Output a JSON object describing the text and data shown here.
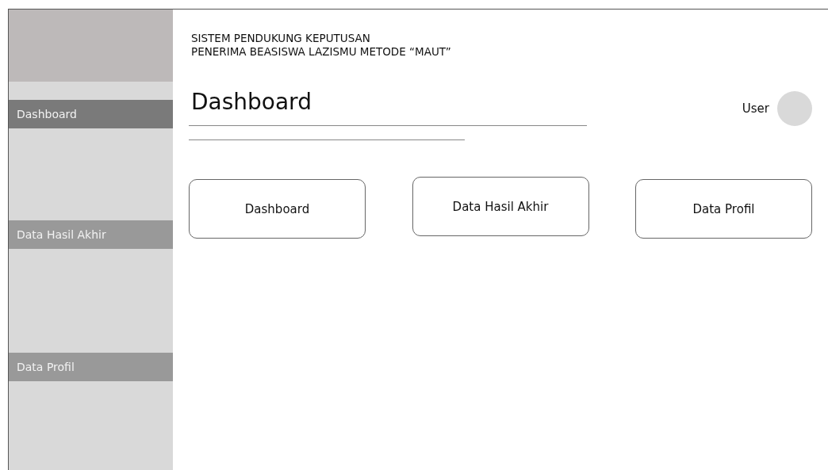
{
  "header": {
    "title_lines": [
      "SISTEM PENDUKUNG KEPUTUSAN",
      "PENERIMA BEASISWA LAZISMU METODE “MAUT”"
    ]
  },
  "sidebar": {
    "items": [
      {
        "label": "Dashboard",
        "selected": true
      },
      {
        "label": "Data Hasil Akhir",
        "selected": false
      },
      {
        "label": "Data Profil",
        "selected": false
      }
    ]
  },
  "page": {
    "heading": "Dashboard",
    "user": "User"
  },
  "cards": [
    {
      "label": "Dashboard"
    },
    {
      "label": "Data Hasil Akhir"
    },
    {
      "label": "Data Profil"
    }
  ]
}
